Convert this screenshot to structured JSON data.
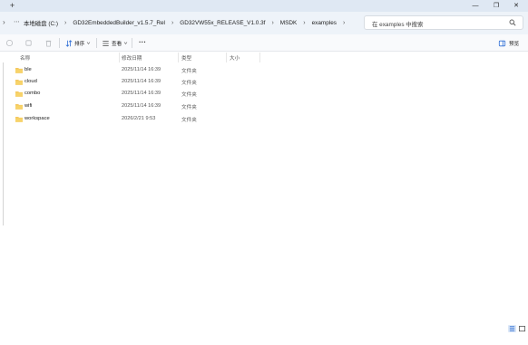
{
  "titlebar": {
    "new_tab": "+",
    "minimize": "—",
    "restore": "❐",
    "close": "✕"
  },
  "address": {
    "nav": "›",
    "more": "⋯",
    "crumbs": [
      "本地磁盘 (C:)",
      "GD32EmbeddedBuilder_v1.5.7_Rel",
      "GD32VW55x_RELEASE_V1.0.3f",
      "MSDK",
      "examples"
    ],
    "separator": "›",
    "search_placeholder": "在 examples 中搜索"
  },
  "toolbar": {
    "sort_label": "排序",
    "view_label": "查看",
    "more": "···",
    "preview_label": "预览"
  },
  "columns": {
    "name": "名称",
    "date": "修改日期",
    "type": "类型",
    "size": "大小"
  },
  "files": [
    {
      "name": "ble",
      "date": "2025/11/14 16:39",
      "type": "文件夹"
    },
    {
      "name": "cloud",
      "date": "2025/11/14 16:39",
      "type": "文件夹"
    },
    {
      "name": "combo",
      "date": "2025/11/14 16:39",
      "type": "文件夹"
    },
    {
      "name": "wifi",
      "date": "2025/11/14 16:39",
      "type": "文件夹"
    },
    {
      "name": "workspace",
      "date": "2026/2/21 9:53",
      "type": "文件夹"
    }
  ],
  "colors": {
    "folder": "#f2c14e",
    "folder_dark": "#dba73a",
    "accent": "#2f6fd6"
  },
  "icons": [
    "search-icon",
    "folder-icon",
    "sort-icon",
    "view-icon",
    "preview-icon",
    "details-view-icon",
    "tiles-view-icon"
  ]
}
